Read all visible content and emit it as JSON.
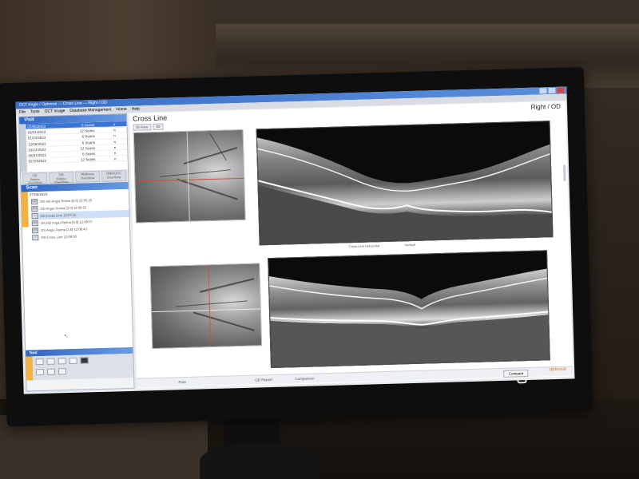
{
  "window": {
    "title": "OCT Angio / Optovue — Cross Line — Right / OD",
    "menu": [
      "File",
      "Tools",
      "OCT Image",
      "Database Management",
      "Home",
      "Help"
    ]
  },
  "visit": {
    "header": "Visit",
    "rows": [
      {
        "date": "07/05/2023",
        "scans": "6 Scans",
        "eye": "n",
        "selected": true
      },
      {
        "date": "03/31/2023",
        "scans": "12 Scans",
        "eye": "n",
        "selected": false
      },
      {
        "date": "01/24/2023",
        "scans": "6 Scans",
        "eye": "n",
        "selected": false
      },
      {
        "date": "12/06/2022",
        "scans": "6 Scans",
        "eye": "n",
        "selected": false
      },
      {
        "date": "10/21/2022",
        "scans": "12 Scans",
        "eye": "n",
        "selected": false
      },
      {
        "date": "06/01/2022",
        "scans": "6 Scans",
        "eye": "n",
        "selected": false
      },
      {
        "date": "02/10/2022",
        "scans": "12 Scans",
        "eye": "n",
        "selected": false
      }
    ],
    "eye_tabs": [
      {
        "line1": "OD",
        "line2": "Retina",
        "line3": "OverView"
      },
      {
        "line1": "OS",
        "line2": "Retina",
        "line3": "OverView"
      },
      {
        "line1": "Wellness",
        "line2": "OverView",
        "line3": ""
      },
      {
        "line1": "ONH/GCC",
        "line2": "OverView",
        "line3": ""
      }
    ]
  },
  "scan": {
    "header": "Scan",
    "date": "07/05/2023",
    "rows": [
      {
        "thumb": "OD",
        "label": "OD HD Angio Retina [6.0]   12:06:25",
        "selected": false
      },
      {
        "thumb": "OS",
        "label": "OD Angio Retina [3.0]   12:06:55",
        "selected": false
      },
      {
        "thumb": "+",
        "label": "OD Cross Line   12:07:15",
        "selected": true
      },
      {
        "thumb": "OS",
        "label": "OS HD Angio Retina [6.0]   12:08:07",
        "selected": false
      },
      {
        "thumb": "OS",
        "label": "OS Angio Retina [3.0]   12:08:40",
        "selected": false
      },
      {
        "thumb": "+",
        "label": "OS Cross Line   12:09:00",
        "selected": false
      }
    ]
  },
  "tool": {
    "header": "Tool"
  },
  "main": {
    "title": "Cross Line",
    "eye": "Right / OD",
    "enface_tabs": [
      "En Face",
      "3D"
    ],
    "oct_top_caption_left": "Cross Line Horizontal",
    "oct_top_caption_right": "Vertical",
    "footer": {
      "print": "Print",
      "report": "OD Report",
      "comparison": "Comparison",
      "compare_button": "Compare",
      "brand": "optovue"
    }
  },
  "colors": {
    "accent": "#3a74d4",
    "header_blue": "#2e66c6",
    "tool_orange": "#f2b23b",
    "crosshair_red": "#d44a3a",
    "brand_orange": "#e07a22"
  }
}
